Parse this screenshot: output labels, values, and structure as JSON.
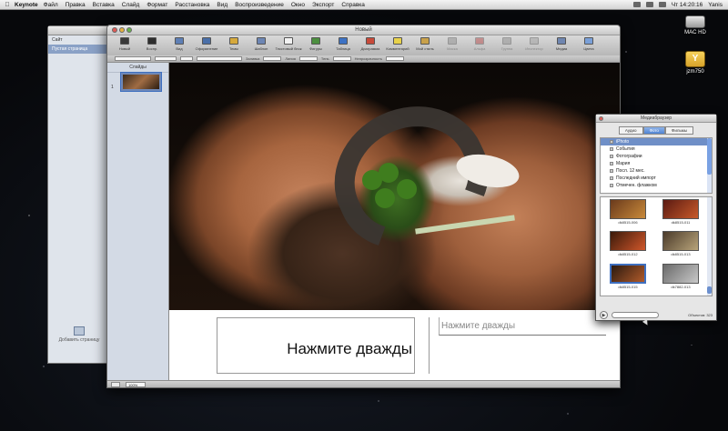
{
  "menubar": {
    "app_name": "Keynote",
    "items": [
      "Файл",
      "Правка",
      "Вставка",
      "Слайд",
      "Формат",
      "Расстановка",
      "Вид",
      "Воспроизведение",
      "Окно",
      "Экспорт",
      "Справка"
    ],
    "clock": "Чт 14:20:16",
    "user": "Yanis"
  },
  "desktop": {
    "hd_label": "MAC HD",
    "usb_label": "jzm750"
  },
  "back_window": {
    "rows": [
      "Сайт",
      "Пустая страница"
    ],
    "add_page_label": "Добавить страницу"
  },
  "keynote": {
    "title": "Новый",
    "toolbar": [
      {
        "label": "Новый",
        "icon": "new-slide-icon",
        "color": "#3a3a3a",
        "enabled": true
      },
      {
        "label": "Воспр.",
        "icon": "play-icon",
        "color": "#2e2e2e",
        "enabled": true
      },
      {
        "label": "Вид",
        "icon": "view-icon",
        "color": "#5e7fb5",
        "enabled": true
      },
      {
        "label": "Оформление",
        "icon": "themes-icon",
        "color": "#4a6fa8",
        "enabled": true
      },
      {
        "label": "Темы",
        "icon": "themes-grid-icon",
        "color": "#d6a93c",
        "enabled": true
      },
      {
        "label": "Шаблон",
        "icon": "masters-icon",
        "color": "#6d86b4",
        "enabled": true
      },
      {
        "label": "Текстовый блок",
        "icon": "text-box-icon",
        "color": "#f2f2f2",
        "enabled": true
      },
      {
        "label": "Фигуры",
        "icon": "shapes-icon",
        "color": "#4c8f3f",
        "enabled": true
      },
      {
        "label": "Таблица",
        "icon": "table-icon",
        "color": "#3d72c4",
        "enabled": true
      },
      {
        "label": "Диаграмма",
        "icon": "chart-icon",
        "color": "#c84a3a",
        "enabled": true
      },
      {
        "label": "Комментарий",
        "icon": "comment-icon",
        "color": "#e8d24a",
        "enabled": true
      },
      {
        "label": "Мой стиль",
        "icon": "style-icon",
        "color": "#c9a14a",
        "enabled": true
      },
      {
        "label": "Маска",
        "icon": "mask-icon",
        "color": "#888888",
        "enabled": false
      },
      {
        "label": "Альфа",
        "icon": "alpha-icon",
        "color": "#b03a3a",
        "enabled": false
      },
      {
        "label": "Группа",
        "icon": "group-icon",
        "color": "#888888",
        "enabled": false
      },
      {
        "label": "Инспектор",
        "icon": "inspector-icon",
        "color": "#9a9a9a",
        "enabled": false
      },
      {
        "label": "Медиа",
        "icon": "media-icon",
        "color": "#6f86b0",
        "enabled": true
      },
      {
        "label": "Цвета",
        "icon": "colors-icon",
        "color": "#7aa0d8",
        "enabled": true
      }
    ],
    "format_bar": {
      "labels": [
        "Заливка",
        "Линия",
        "Тень",
        "Непрозрачность"
      ]
    },
    "navigator_header": "Слайды",
    "slide_number": "1",
    "title_placeholder": "Нажмите дважды",
    "subtitle_placeholder": "Нажмите дважды",
    "zoom": "100%"
  },
  "media_browser": {
    "title": "Медиабраузер",
    "tabs": [
      "Аудио",
      "Фото",
      "Фильмы"
    ],
    "active_tab": "Фото",
    "tree": [
      {
        "label": "iPhoto",
        "selected": true
      },
      {
        "label": "События",
        "selected": false
      },
      {
        "label": "Фотографии",
        "selected": false
      },
      {
        "label": "Мария",
        "selected": false
      },
      {
        "label": "Посл. 12 мес.",
        "selected": false
      },
      {
        "label": "Последний импорт",
        "selected": false
      },
      {
        "label": "Отмечен. флажком",
        "selected": false
      }
    ],
    "photos": [
      {
        "caption": "dk8515-006",
        "colors": [
          "#6a3a1c",
          "#c98a3a"
        ],
        "selected": false
      },
      {
        "caption": "dk8515-011",
        "colors": [
          "#5a1a12",
          "#c85a2a"
        ],
        "selected": false
      },
      {
        "caption": "dk8515-012",
        "colors": [
          "#3a1a0a",
          "#d0562a"
        ],
        "selected": false
      },
      {
        "caption": "dk8515-013",
        "colors": [
          "#4a3a2a",
          "#b8a47a"
        ],
        "selected": false
      },
      {
        "caption": "dk8515-015",
        "colors": [
          "#2a1a10",
          "#b05a2a"
        ],
        "selected": true
      },
      {
        "caption": "dk7882-013",
        "colors": [
          "#6a6a6a",
          "#c8c8c8"
        ],
        "selected": false
      }
    ],
    "search_placeholder": "",
    "count": "Объектов: 323"
  }
}
